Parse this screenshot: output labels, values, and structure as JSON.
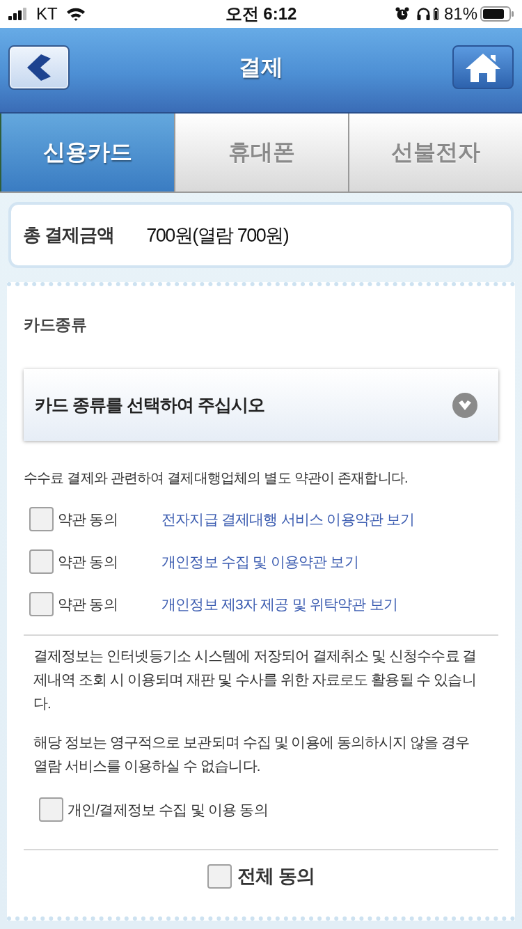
{
  "status_bar": {
    "carrier": "KT",
    "time": "오전 6:12",
    "battery": "81%"
  },
  "header": {
    "title": "결제"
  },
  "tabs": [
    {
      "label": "신용카드",
      "selected": true
    },
    {
      "label": "휴대폰",
      "selected": false
    },
    {
      "label": "선불전자",
      "selected": false
    }
  ],
  "total": {
    "label": "총 결제금액",
    "amount": "700원(열람 700원)"
  },
  "card_type": {
    "label": "카드종류",
    "prompt": "카드 종류를 선택하여 주십시오"
  },
  "notice": "수수료 결제와 관련하여 결제대행업체의 별도 약관이 존재합니다.",
  "terms": [
    {
      "label": "약관 동의",
      "checked": false,
      "link": "전자지급 결제대행 서비스 이용약관 보기"
    },
    {
      "label": "약관 동의",
      "checked": false,
      "link": "개인정보 수집 및 이용약관 보기"
    },
    {
      "label": "약관 동의",
      "checked": false,
      "link": "개인정보 제3자 제공 및 위탁약관 보기"
    }
  ],
  "info_paragraphs": [
    "결제정보는 인터넷등기소 시스템에 저장되어 결제취소 및 신청수수료 결제내역 조회 시 이용되며 재판 및 수사를 위한 자료로도 활용될 수 있습니다.",
    "해당 정보는 영구적으로 보관되며 수집 및 이용에 동의하시지 않을 경우 열람 서비스를 이용하실 수 없습니다."
  ],
  "consent": {
    "label": "개인/결제정보 수집 및 이용 동의",
    "checked": false
  },
  "agree_all": {
    "label": "전체 동의",
    "checked": false
  }
}
